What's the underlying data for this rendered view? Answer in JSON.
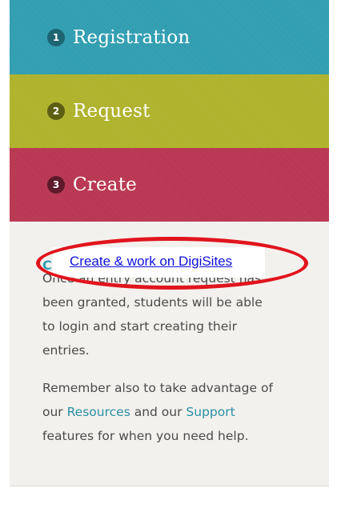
{
  "steps": [
    {
      "number": "1",
      "label": "Registration"
    },
    {
      "number": "2",
      "label": "Request"
    },
    {
      "number": "3",
      "label": "Create"
    }
  ],
  "content": {
    "heading_partial": "C",
    "paragraph1_lines": [
      "Once an entry account request has",
      "been granted, students will be able",
      "to login and start creating their",
      "entries."
    ],
    "paragraph2": {
      "line1": "Remember also to take advantage of",
      "line2_before": "our ",
      "resources_link": "Resources",
      "line2_middle": " and our ",
      "support_link": "Support",
      "line3": "features for when you need help."
    }
  },
  "highlight": {
    "link_text": "Create & work on DigiSites",
    "annotation_color": "#e1141c"
  },
  "colors": {
    "registration": "#2f9db0",
    "request": "#aeb22a",
    "create": "#b83550",
    "link": "#2a8fa3"
  }
}
